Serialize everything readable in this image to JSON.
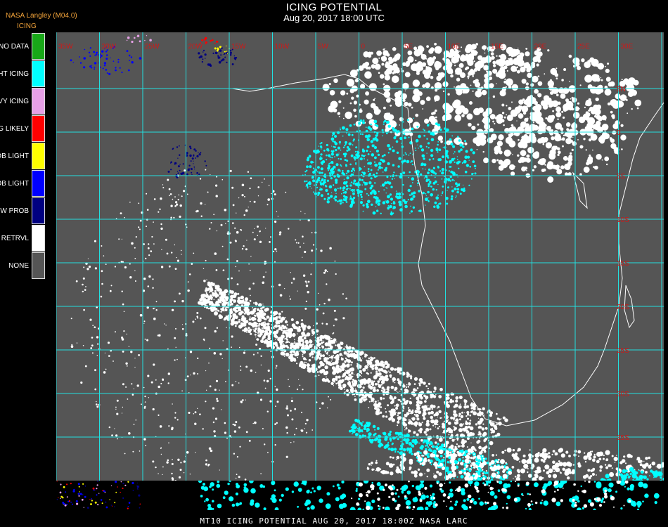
{
  "header": {
    "title": "ICING POTENTIAL",
    "datetime": "Aug 20, 2017 18:00 UTC",
    "org": "NASA Langley (M04.0)"
  },
  "legend": {
    "heading": "ICING",
    "items": [
      {
        "label": "NO DATA",
        "color": "#18a818"
      },
      {
        "label": "NIGHT ICING",
        "color": "#00ffff"
      },
      {
        "label": "HEAVY ICING",
        "color": "#e6a0e6"
      },
      {
        "label": "MOG LIKELY",
        "color": "#ff0000"
      },
      {
        "label": "HI PROB LIGHT",
        "color": "#ffff00"
      },
      {
        "label": "LO PROB LIGHT",
        "color": "#0000ff"
      },
      {
        "label": "LOW PROB",
        "color": "#000080"
      },
      {
        "label": "NO RETRVL",
        "color": "#ffffff"
      },
      {
        "label": "NONE",
        "color": "#555555"
      }
    ]
  },
  "map": {
    "background_color": "#555555",
    "grid_color": "#22e0e0",
    "label_color": "#d01818",
    "lon_labels": [
      "35W",
      "30W",
      "25W",
      "20W",
      "15W",
      "10W",
      "5W",
      "0",
      "5E",
      "10E",
      "15E",
      "20E",
      "25E",
      "30E",
      "35E"
    ],
    "lat_labels": [
      "5N",
      "0",
      "5S",
      "10S",
      "15S",
      "20S",
      "25S",
      "30S",
      "35S"
    ]
  },
  "footer": {
    "text": "MT10  ICING POTENTIAL   AUG 20, 2017 18:00Z   NASA LARC"
  }
}
